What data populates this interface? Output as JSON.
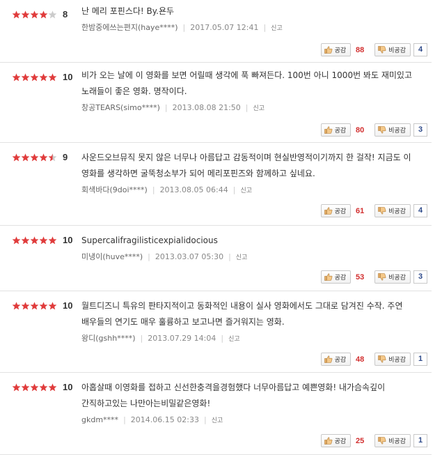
{
  "labels": {
    "report": "신고",
    "sympathy": "공감",
    "antipathy": "비공감"
  },
  "colors": {
    "star_on": "#e03c3c",
    "star_off": "#cccccc",
    "sympathy_count": "#d22e2e",
    "antipathy_count": "#2e4a8a"
  },
  "reviews": [
    {
      "stars": [
        1,
        1,
        1,
        1,
        0
      ],
      "score": "8",
      "text": "난 메리 포핀스다! By.욘두",
      "author": "한밤중에쓰는편지(haye****)",
      "date": "2017.05.07 12:41",
      "sympathy": "88",
      "antipathy": "4"
    },
    {
      "stars": [
        1,
        1,
        1,
        1,
        1
      ],
      "score": "10",
      "text": "비가 오는 날에 이 영화를 보면 어릴때 생각에 푹 빠져든다. 100번 아니 1000번 봐도 재미있고 노래들이 좋은 영화. 명작이다.",
      "author": "창공TEARS(simo****)",
      "date": "2013.08.08 21:50",
      "sympathy": "80",
      "antipathy": "3"
    },
    {
      "stars": [
        1,
        1,
        1,
        1,
        0.5
      ],
      "score": "9",
      "text": "사운드오브뮤직 못지 않은 너무나 아름답고 감동적이며 현실반영적이기까지 한 걸작! 지금도 이 영화를 생각하면 굴뚝청소부가 되어 메리포핀즈와 함께하고 싶네요.",
      "author": "회색바다(9doi****)",
      "date": "2013.08.05 06:44",
      "sympathy": "61",
      "antipathy": "4"
    },
    {
      "stars": [
        1,
        1,
        1,
        1,
        1
      ],
      "score": "10",
      "text": "Supercalifragilisticexpialidocious",
      "author": "미냉이(huve****)",
      "date": "2013.03.07 05:30",
      "sympathy": "53",
      "antipathy": "3"
    },
    {
      "stars": [
        1,
        1,
        1,
        1,
        1
      ],
      "score": "10",
      "text": "월트디즈니 특유의 판타지적이고 동화적인 내용이 실사 영화에서도 그대로 담겨진 수작. 주연 배우들의 연기도 매우 훌륭하고 보고나면 즐거워지는 영화.",
      "author": "왕디(gshh****)",
      "date": "2013.07.29 14:04",
      "sympathy": "48",
      "antipathy": "1"
    },
    {
      "stars": [
        1,
        1,
        1,
        1,
        1
      ],
      "score": "10",
      "text": "아홉살때 이영화를 접하고 신선한충격을경험했다 너무아름답고 예쁜영화! 내가슴속깊이 간직하고있는 나만아는비밀같은영화!",
      "author": "gkdm****",
      "date": "2014.06.15 02:33",
      "sympathy": "25",
      "antipathy": "1"
    }
  ]
}
